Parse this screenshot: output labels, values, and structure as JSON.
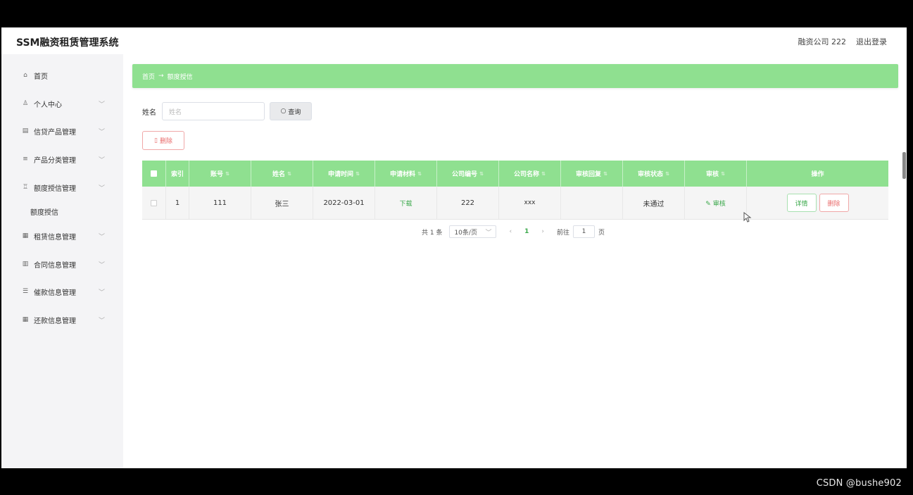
{
  "app": {
    "title": "SSM融资租赁管理系统",
    "user": "融资公司 222",
    "logout": "退出登录"
  },
  "sidebar": {
    "items": [
      {
        "label": "首页",
        "icon": "home-icon",
        "glyph": "⌂",
        "chevron": false
      },
      {
        "label": "个人中心",
        "icon": "person-icon",
        "glyph": "♙",
        "chevron": true
      },
      {
        "label": "信贷产品管理",
        "icon": "doc-icon",
        "glyph": "▤",
        "chevron": true
      },
      {
        "label": "产品分类管理",
        "icon": "stack-icon",
        "glyph": "≡",
        "chevron": true
      },
      {
        "label": "额度授信管理",
        "icon": "user-group-icon",
        "glyph": "♖",
        "chevron": true
      },
      {
        "label": "额度授信",
        "icon": "",
        "glyph": "",
        "chevron": false,
        "sub": true
      },
      {
        "label": "租赁信息管理",
        "icon": "grid-icon",
        "glyph": "▦",
        "chevron": true
      },
      {
        "label": "合同信息管理",
        "icon": "clipboard-icon",
        "glyph": "▥",
        "chevron": true
      },
      {
        "label": "催款信息管理",
        "icon": "list-icon",
        "glyph": "☰",
        "chevron": true
      },
      {
        "label": "还款信息管理",
        "icon": "grid-icon",
        "glyph": "▦",
        "chevron": true
      }
    ]
  },
  "breadcrumb": {
    "home": "首页",
    "separator": "→",
    "current": "额度授信"
  },
  "search": {
    "label": "姓名",
    "placeholder": "姓名",
    "button": "查询"
  },
  "toolbar": {
    "delete_label": "删除"
  },
  "table": {
    "columns": [
      "索引",
      "账号",
      "姓名",
      "申请时间",
      "申请材料",
      "公司编号",
      "公司名称",
      "审核回复",
      "审核状态",
      "审核",
      "操作"
    ],
    "rows": [
      {
        "index": "1",
        "account": "111",
        "name": "张三",
        "apply_time": "2022-03-01",
        "materials": "下载",
        "company_no": "222",
        "company_name": "xxx",
        "reply": "",
        "status": "未通过",
        "review": "审核",
        "detail": "详情",
        "delete": "删除"
      }
    ]
  },
  "pager": {
    "total": "共 1 条",
    "page_size": "10条/页",
    "current": "1",
    "goto_prefix": "前往",
    "goto_value": "1",
    "goto_suffix": "页"
  },
  "watermark": "CSDN @bushe902",
  "colors": {
    "accent": "#8fe090",
    "link": "#3aa84a",
    "danger": "#e96b6b"
  }
}
